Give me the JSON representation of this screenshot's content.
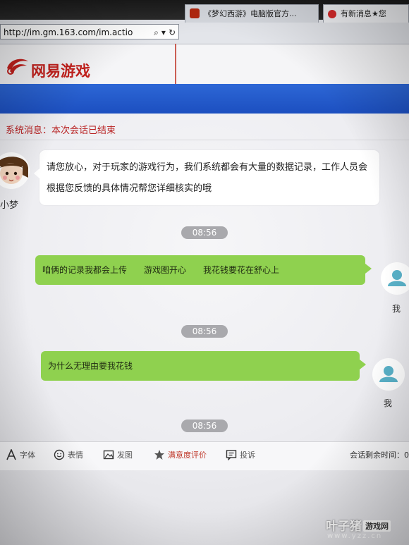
{
  "browser": {
    "address": "http://im.gm.163.com/im.actio",
    "address_icons": [
      "search-icon",
      "dropdown-icon",
      "refresh-icon"
    ],
    "tabs": [
      {
        "label": "《梦幻西游》电脑版官方..."
      },
      {
        "label": "有新消息★您"
      }
    ]
  },
  "site": {
    "logo_text": "网易游戏",
    "brand_color": "#c5211d",
    "band_color": "#2459cc"
  },
  "system_message": {
    "prefix": "系统消息：",
    "text": "本次会话已结束"
  },
  "agent": {
    "name": "小梦",
    "message": "请您放心，对于玩家的游戏行为，我们系统都会有大量的数据记录，工作人员会根据您反馈的具体情况帮您详细核实的哦"
  },
  "me": {
    "label": "我"
  },
  "messages": [
    {
      "time": "08:56",
      "segments": [
        "咱俩的记录我都会上传",
        "游戏图开心",
        "我花钱要花在舒心上"
      ]
    },
    {
      "time": "08:56",
      "segments": [
        "为什么无理由要我花钱"
      ]
    }
  ],
  "last_time": "08:56",
  "toolbar": {
    "font_label": "字体",
    "emoji_label": "表情",
    "image_label": "发图",
    "rate_label": "满意度评价",
    "complain_label": "投诉",
    "remaining_label": "会话剩余时间：0"
  },
  "watermark": {
    "main": "叶子猪",
    "badge": "游戏网",
    "url": "www.yzz.cn"
  },
  "colors": {
    "my_bubble": "#8fd14f",
    "agent_bubble": "#ffffff",
    "time_pill": "#a9a9ad",
    "system_text": "#b81f1f"
  }
}
